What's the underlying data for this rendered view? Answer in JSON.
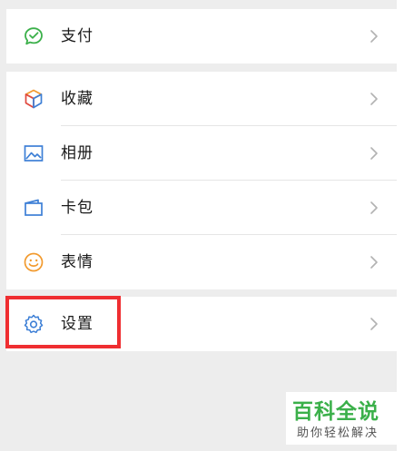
{
  "groups": [
    {
      "items": [
        {
          "label": "支付",
          "icon": "payment-icon"
        }
      ]
    },
    {
      "items": [
        {
          "label": "收藏",
          "icon": "favorites-cube-icon"
        },
        {
          "label": "相册",
          "icon": "album-image-icon"
        },
        {
          "label": "卡包",
          "icon": "card-wallet-icon"
        },
        {
          "label": "表情",
          "icon": "emoji-smile-icon"
        }
      ]
    },
    {
      "items": [
        {
          "label": "设置",
          "icon": "settings-gear-icon"
        }
      ]
    }
  ],
  "watermark": {
    "title": "百科全说",
    "subtitle": "助你轻松解决"
  },
  "colors": {
    "payment": "#3bb04a",
    "accent_blue": "#3d7fd6",
    "emoji": "#f29a2e",
    "highlight": "#ef2e31",
    "watermark_green": "#3bb04a",
    "background": "#ededed"
  }
}
